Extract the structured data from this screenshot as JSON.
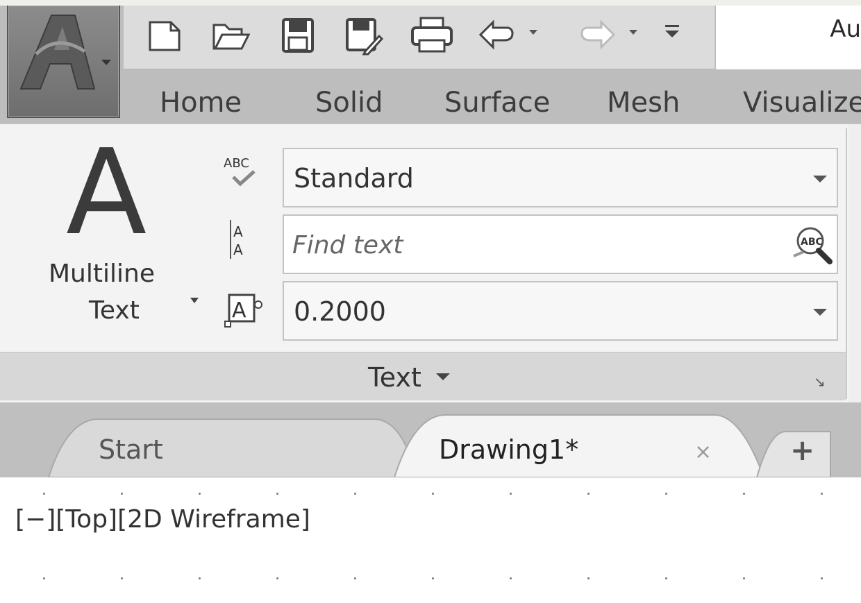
{
  "app": {
    "title_partial": "Au",
    "menu_button_icon": "autocad-a-logo"
  },
  "quick_access": [
    {
      "name": "new-icon"
    },
    {
      "name": "open-icon"
    },
    {
      "name": "save-icon"
    },
    {
      "name": "save-as-icon"
    },
    {
      "name": "plot-icon"
    },
    {
      "name": "undo-icon"
    },
    {
      "name": "redo-icon"
    },
    {
      "name": "customize-icon"
    }
  ],
  "ribbon_tabs": [
    "Home",
    "Solid",
    "Surface",
    "Mesh",
    "Visualize"
  ],
  "text_panel": {
    "multiline_line1": "Multiline",
    "multiline_line2": "Text",
    "style_value": "Standard",
    "find_placeholder": "Find text",
    "height_value": "0.2000",
    "panel_title": "Text",
    "launcher_glyph": "↘"
  },
  "doc_tabs": {
    "start": "Start",
    "drawing": "Drawing1*",
    "close_glyph": "×",
    "new_glyph": "+"
  },
  "viewport": {
    "label": "[−][Top][2D Wireframe]"
  },
  "colors": {
    "ribbon_bg": "#f3f3f3",
    "tab_band": "#bdbdbd",
    "app_button": "#7a7a7a"
  }
}
